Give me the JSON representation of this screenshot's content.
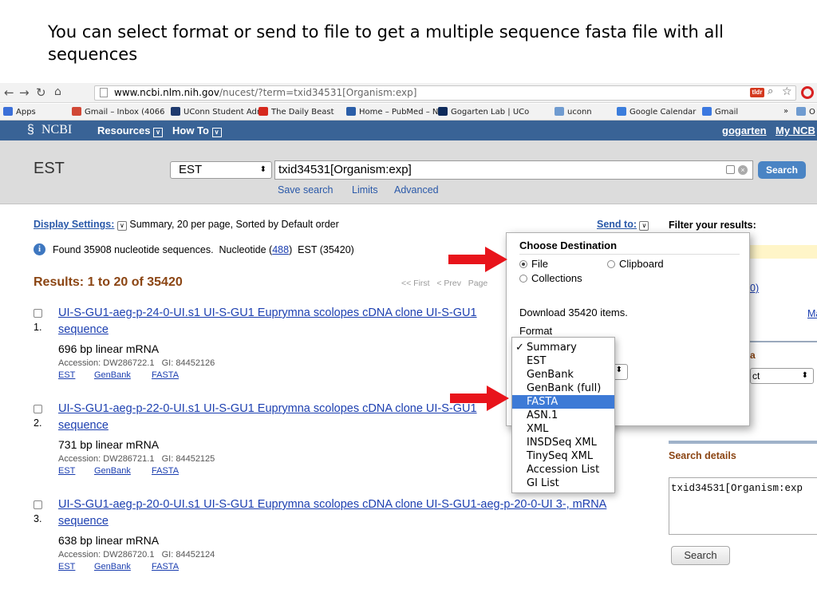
{
  "caption": "You can select format or send to file to get a multiple sequence fasta file with all sequences",
  "browser": {
    "url_host": "www.ncbi.nlm.nih.gov",
    "url_path": "/nucest/?term=txid34531[Organism:exp]",
    "bookmarks": [
      {
        "label": "Apps",
        "icon": "apps-grid-icon",
        "color": "#3b6fd8"
      },
      {
        "label": "Gmail – Inbox (4066",
        "icon": "gmail-icon",
        "color": "#d14836"
      },
      {
        "label": "UConn Student Adm",
        "icon": "uconn-icon",
        "color": "#1f3a6e"
      },
      {
        "label": "The Daily Beast",
        "icon": "daily-beast-icon",
        "color": "#d6281d"
      },
      {
        "label": "Home – PubMed – N",
        "icon": "pubmed-icon",
        "color": "#2b5ea8"
      },
      {
        "label": "Gogarten Lab | UCo",
        "icon": "uconn-husky-icon",
        "color": "#0d2a5b"
      },
      {
        "label": "uconn",
        "icon": "folder-icon",
        "color": "#6f9bd0"
      },
      {
        "label": "Google Calendar",
        "icon": "calendar-icon",
        "color": "#3b7ddc"
      },
      {
        "label": "Gmail",
        "icon": "google-icon",
        "color": "#3b78e0"
      },
      {
        "label": "»",
        "icon": "more-icon",
        "color": "#666666"
      },
      {
        "label": "O",
        "icon": "folder-icon",
        "color": "#6f9bd0"
      }
    ]
  },
  "ncbi": {
    "logo": "NCBI",
    "resources": "Resources",
    "howto": "How To",
    "user": "gogarten",
    "myncbi": "My NCB",
    "db_title": "EST",
    "db_select": "EST",
    "search_term": "txid34531[Organism:exp]",
    "search_button": "Search",
    "links": {
      "save": "Save search",
      "limits": "Limits",
      "advanced": "Advanced"
    }
  },
  "display": {
    "settings_label": "Display Settings:",
    "settings_value": "Summary, 20 per page, Sorted by Default order",
    "send_to": "Send to:",
    "filter": "Filter your results:",
    "found_text": "Found 35908 nucleotide sequences.  Nucleotide (",
    "found_link": "488",
    "found_rest": ")  EST (35420)",
    "results_header": "Results: 1 to 20 of 35420",
    "pager": "<< First   < Prev   Page"
  },
  "results": [
    {
      "num": "1.",
      "title_a": "UI-S-GU1-aeg-p-24-0-UI.s1 UI-S-GU1 Euprymna scolopes cDNA clone UI-S-GU1",
      "title_b": "sequence",
      "desc": "696 bp linear mRNA",
      "accession": "Accession: DW286722.1   GI: 84452126"
    },
    {
      "num": "2.",
      "title_a": "UI-S-GU1-aeg-p-22-0-UI.s1 UI-S-GU1 Euprymna scolopes cDNA clone UI-S-GU1",
      "title_b": "sequence",
      "desc": "731 bp linear mRNA",
      "accession": "Accession: DW286721.1   GI: 84452125"
    },
    {
      "num": "3.",
      "title_a": "UI-S-GU1-aeg-p-20-0-UI.s1 UI-S-GU1 Euprymna scolopes cDNA clone UI-S-GU1-aeg-p-20-0-UI 3-, mRNA",
      "title_b": "sequence",
      "desc": "638 bp linear mRNA",
      "accession": "Accession: DW286720.1   GI: 84452124"
    }
  ],
  "result_links": {
    "est": "EST",
    "genbank": "GenBank",
    "fasta": "FASTA"
  },
  "popup": {
    "title": "Choose Destination",
    "file": "File",
    "clipboard": "Clipboard",
    "collections": "Collections",
    "download": "Download 35420 items.",
    "format_label": "Format"
  },
  "formats": [
    {
      "label": "Summary",
      "checked": true
    },
    {
      "label": "EST"
    },
    {
      "label": "GenBank"
    },
    {
      "label": "GenBank (full)"
    },
    {
      "label": "FASTA",
      "highlighted": true
    },
    {
      "label": "ASN.1"
    },
    {
      "label": "XML"
    },
    {
      "label": "INSDSeq XML"
    },
    {
      "label": "TinySeq XML"
    },
    {
      "label": "Accession List"
    },
    {
      "label": "GI List"
    }
  ],
  "right_panel": {
    "paren_link": "0)",
    "ma": "Ma",
    "a_label": "a",
    "ct_label": "ct",
    "details_title": "Search details",
    "details_text": "txid34531[Organism:exp",
    "search_button": "Search"
  },
  "colors": {
    "ncbi_blue": "#396396",
    "arrow_red": "#e8141b",
    "link_blue": "#1c3fb0",
    "results_brown": "#8b4513",
    "highlight": "#3d7ad6"
  }
}
